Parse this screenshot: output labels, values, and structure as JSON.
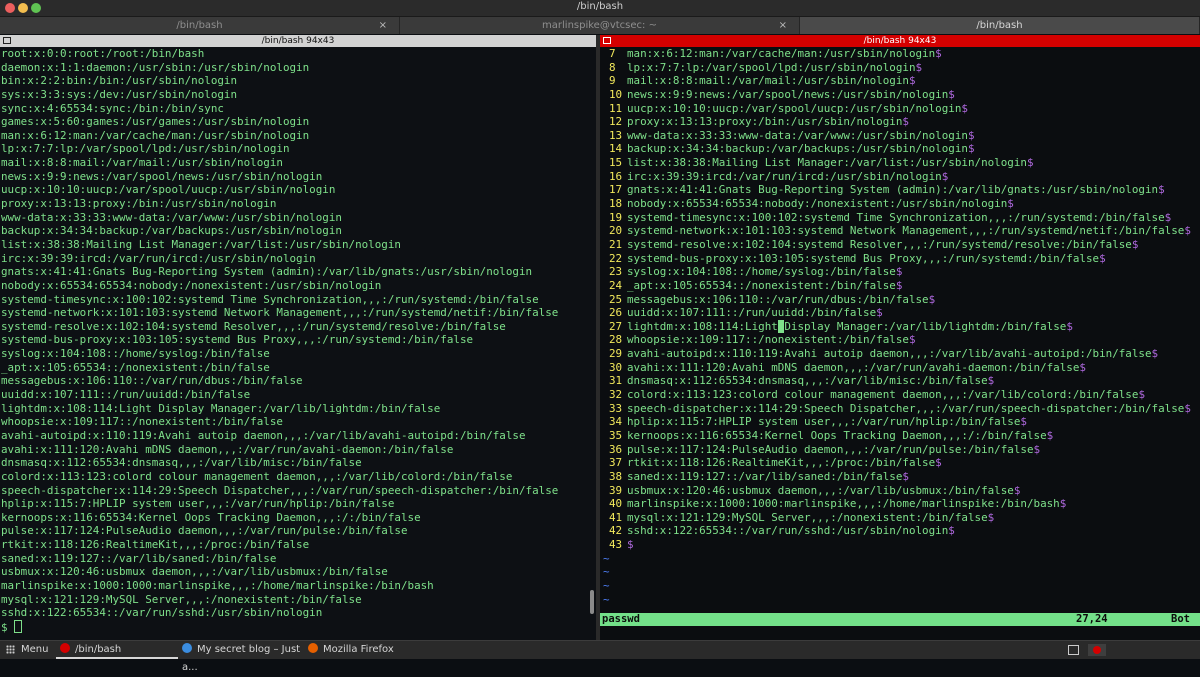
{
  "window": {
    "title": "/bin/bash"
  },
  "tabs": [
    {
      "label": "/bin/bash",
      "close": "×"
    },
    {
      "label": "marlinspike@vtcsec: ~",
      "close": "×"
    },
    {
      "label": "/bin/bash",
      "close": ""
    }
  ],
  "left_pane": {
    "title": "/bin/bash 94x43",
    "lines": [
      "root:x:0:0:root:/root:/bin/bash",
      "daemon:x:1:1:daemon:/usr/sbin:/usr/sbin/nologin",
      "bin:x:2:2:bin:/bin:/usr/sbin/nologin",
      "sys:x:3:3:sys:/dev:/usr/sbin/nologin",
      "sync:x:4:65534:sync:/bin:/bin/sync",
      "games:x:5:60:games:/usr/games:/usr/sbin/nologin",
      "man:x:6:12:man:/var/cache/man:/usr/sbin/nologin",
      "lp:x:7:7:lp:/var/spool/lpd:/usr/sbin/nologin",
      "mail:x:8:8:mail:/var/mail:/usr/sbin/nologin",
      "news:x:9:9:news:/var/spool/news:/usr/sbin/nologin",
      "uucp:x:10:10:uucp:/var/spool/uucp:/usr/sbin/nologin",
      "proxy:x:13:13:proxy:/bin:/usr/sbin/nologin",
      "www-data:x:33:33:www-data:/var/www:/usr/sbin/nologin",
      "backup:x:34:34:backup:/var/backups:/usr/sbin/nologin",
      "list:x:38:38:Mailing List Manager:/var/list:/usr/sbin/nologin",
      "irc:x:39:39:ircd:/var/run/ircd:/usr/sbin/nologin",
      "gnats:x:41:41:Gnats Bug-Reporting System (admin):/var/lib/gnats:/usr/sbin/nologin",
      "nobody:x:65534:65534:nobody:/nonexistent:/usr/sbin/nologin",
      "systemd-timesync:x:100:102:systemd Time Synchronization,,,:/run/systemd:/bin/false",
      "systemd-network:x:101:103:systemd Network Management,,,:/run/systemd/netif:/bin/false",
      "systemd-resolve:x:102:104:systemd Resolver,,,:/run/systemd/resolve:/bin/false",
      "systemd-bus-proxy:x:103:105:systemd Bus Proxy,,,:/run/systemd:/bin/false",
      "syslog:x:104:108::/home/syslog:/bin/false",
      "_apt:x:105:65534::/nonexistent:/bin/false",
      "messagebus:x:106:110::/var/run/dbus:/bin/false",
      "uuidd:x:107:111::/run/uuidd:/bin/false",
      "lightdm:x:108:114:Light Display Manager:/var/lib/lightdm:/bin/false",
      "whoopsie:x:109:117::/nonexistent:/bin/false",
      "avahi-autoipd:x:110:119:Avahi autoip daemon,,,:/var/lib/avahi-autoipd:/bin/false",
      "avahi:x:111:120:Avahi mDNS daemon,,,:/var/run/avahi-daemon:/bin/false",
      "dnsmasq:x:112:65534:dnsmasq,,,:/var/lib/misc:/bin/false",
      "colord:x:113:123:colord colour management daemon,,,:/var/lib/colord:/bin/false",
      "speech-dispatcher:x:114:29:Speech Dispatcher,,,:/var/run/speech-dispatcher:/bin/false",
      "hplip:x:115:7:HPLIP system user,,,:/var/run/hplip:/bin/false",
      "kernoops:x:116:65534:Kernel Oops Tracking Daemon,,,:/:/bin/false",
      "pulse:x:117:124:PulseAudio daemon,,,:/var/run/pulse:/bin/false",
      "rtkit:x:118:126:RealtimeKit,,,:/proc:/bin/false",
      "saned:x:119:127::/var/lib/saned:/bin/false",
      "usbmux:x:120:46:usbmux daemon,,,:/var/lib/usbmux:/bin/false",
      "marlinspike:x:1000:1000:marlinspike,,,:/home/marlinspike:/bin/bash",
      "mysql:x:121:129:MySQL Server,,,:/nonexistent:/bin/false",
      "sshd:x:122:65534::/var/run/sshd:/usr/sbin/nologin"
    ],
    "prompt": "$"
  },
  "right_pane": {
    "title": "/bin/bash 94x43",
    "eol_marker": "$",
    "tilde": "~",
    "lines": [
      {
        "n": "7",
        "t": "man:x:6:12:man:/var/cache/man:/usr/sbin/nologin"
      },
      {
        "n": "8",
        "t": "lp:x:7:7:lp:/var/spool/lpd:/usr/sbin/nologin"
      },
      {
        "n": "9",
        "t": "mail:x:8:8:mail:/var/mail:/usr/sbin/nologin"
      },
      {
        "n": "10",
        "t": "news:x:9:9:news:/var/spool/news:/usr/sbin/nologin"
      },
      {
        "n": "11",
        "t": "uucp:x:10:10:uucp:/var/spool/uucp:/usr/sbin/nologin"
      },
      {
        "n": "12",
        "t": "proxy:x:13:13:proxy:/bin:/usr/sbin/nologin"
      },
      {
        "n": "13",
        "t": "www-data:x:33:33:www-data:/var/www:/usr/sbin/nologin"
      },
      {
        "n": "14",
        "t": "backup:x:34:34:backup:/var/backups:/usr/sbin/nologin"
      },
      {
        "n": "15",
        "t": "list:x:38:38:Mailing List Manager:/var/list:/usr/sbin/nologin"
      },
      {
        "n": "16",
        "t": "irc:x:39:39:ircd:/var/run/ircd:/usr/sbin/nologin"
      },
      {
        "n": "17",
        "t": "gnats:x:41:41:Gnats Bug-Reporting System (admin):/var/lib/gnats:/usr/sbin/nologin"
      },
      {
        "n": "18",
        "t": "nobody:x:65534:65534:nobody:/nonexistent:/usr/sbin/nologin"
      },
      {
        "n": "19",
        "t": "systemd-timesync:x:100:102:systemd Time Synchronization,,,:/run/systemd:/bin/false"
      },
      {
        "n": "20",
        "t": "systemd-network:x:101:103:systemd Network Management,,,:/run/systemd/netif:/bin/false"
      },
      {
        "n": "21",
        "t": "systemd-resolve:x:102:104:systemd Resolver,,,:/run/systemd/resolve:/bin/false"
      },
      {
        "n": "22",
        "t": "systemd-bus-proxy:x:103:105:systemd Bus Proxy,,,:/run/systemd:/bin/false"
      },
      {
        "n": "23",
        "t": "syslog:x:104:108::/home/syslog:/bin/false"
      },
      {
        "n": "24",
        "t": "_apt:x:105:65534::/nonexistent:/bin/false"
      },
      {
        "n": "25",
        "t": "messagebus:x:106:110::/var/run/dbus:/bin/false"
      },
      {
        "n": "26",
        "t": "uuidd:x:107:111::/run/uuidd:/bin/false"
      },
      {
        "n": "27",
        "t": "lightdm:x:108:114:Light Display Manager:/var/lib/lightdm:/bin/false",
        "cursor_after": "lightdm:x:108:114:Light"
      },
      {
        "n": "28",
        "t": "whoopsie:x:109:117::/nonexistent:/bin/false"
      },
      {
        "n": "29",
        "t": "avahi-autoipd:x:110:119:Avahi autoip daemon,,,:/var/lib/avahi-autoipd:/bin/false"
      },
      {
        "n": "30",
        "t": "avahi:x:111:120:Avahi mDNS daemon,,,:/var/run/avahi-daemon:/bin/false"
      },
      {
        "n": "31",
        "t": "dnsmasq:x:112:65534:dnsmasq,,,:/var/lib/misc:/bin/false"
      },
      {
        "n": "32",
        "t": "colord:x:113:123:colord colour management daemon,,,:/var/lib/colord:/bin/false"
      },
      {
        "n": "33",
        "t": "speech-dispatcher:x:114:29:Speech Dispatcher,,,:/var/run/speech-dispatcher:/bin/false"
      },
      {
        "n": "34",
        "t": "hplip:x:115:7:HPLIP system user,,,:/var/run/hplip:/bin/false"
      },
      {
        "n": "35",
        "t": "kernoops:x:116:65534:Kernel Oops Tracking Daemon,,,:/:/bin/false"
      },
      {
        "n": "36",
        "t": "pulse:x:117:124:PulseAudio daemon,,,:/var/run/pulse:/bin/false"
      },
      {
        "n": "37",
        "t": "rtkit:x:118:126:RealtimeKit,,,:/proc:/bin/false"
      },
      {
        "n": "38",
        "t": "saned:x:119:127::/var/lib/saned:/bin/false"
      },
      {
        "n": "39",
        "t": "usbmux:x:120:46:usbmux daemon,,,:/var/lib/usbmux:/bin/false"
      },
      {
        "n": "40",
        "t": "marlinspike:x:1000:1000:marlinspike,,,:/home/marlinspike:/bin/bash"
      },
      {
        "n": "41",
        "t": "mysql:x:121:129:MySQL Server,,,:/nonexistent:/bin/false"
      },
      {
        "n": "42",
        "t": "sshd:x:122:65534::/var/run/sshd:/usr/sbin/nologin"
      },
      {
        "n": "43",
        "t": ""
      }
    ],
    "tilde_count": 4,
    "status": {
      "filename": "passwd",
      "position": "27,24",
      "scroll": "Bot"
    }
  },
  "taskbar": {
    "menu_label": "Menu",
    "tasks": [
      {
        "label": "/bin/bash",
        "icon": "terminal-icon",
        "color": "#d40000"
      },
      {
        "label": "My secret blog – Just a...",
        "icon": "chrome-icon",
        "color": "#3b8de0"
      },
      {
        "label": "Mozilla Firefox",
        "icon": "firefox-icon",
        "color": "#e66000"
      }
    ]
  },
  "colors": {
    "term_green": "#7ee08a",
    "line_number": "#f2e95c",
    "eol_marker": "#b06ae0",
    "tilde": "#4d7cf2",
    "active_pane_title": "#d40000"
  }
}
